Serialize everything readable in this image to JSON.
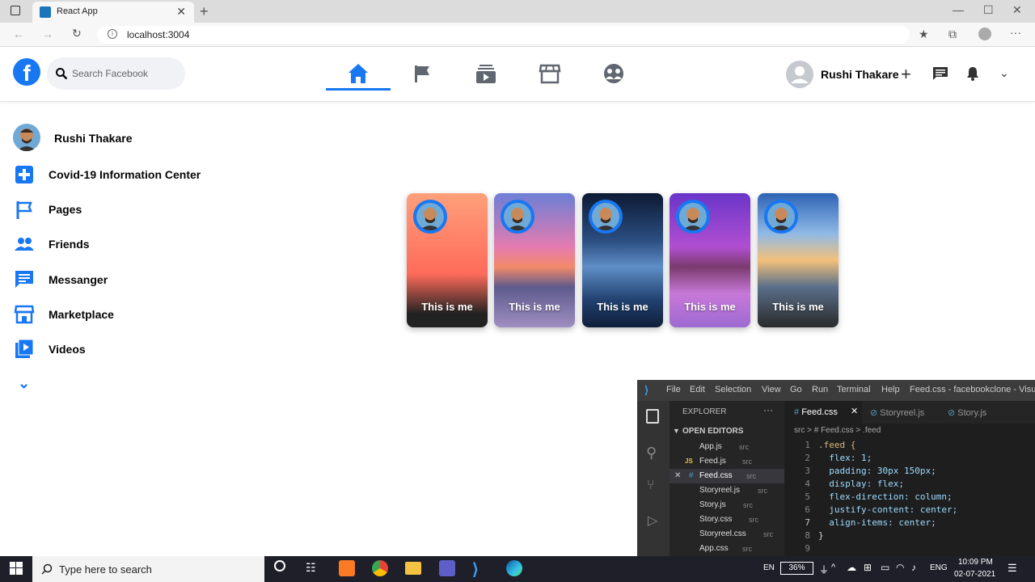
{
  "browser": {
    "tab_title": "React App",
    "url": "localhost:3004"
  },
  "header": {
    "search_placeholder": "Search Facebook",
    "user_name": "Rushi Thakare"
  },
  "sidebar": {
    "items": [
      {
        "label": "Rushi Thakare",
        "icon": "avatar"
      },
      {
        "label": "Covid-19 Information Center",
        "icon": "plus-box-icon"
      },
      {
        "label": "Pages",
        "icon": "flag-icon"
      },
      {
        "label": "Friends",
        "icon": "people-icon"
      },
      {
        "label": "Messanger",
        "icon": "chat-icon"
      },
      {
        "label": "Marketplace",
        "icon": "store-icon"
      },
      {
        "label": "Videos",
        "icon": "video-library-icon"
      }
    ]
  },
  "stories": [
    {
      "caption": "This is me"
    },
    {
      "caption": "This is me"
    },
    {
      "caption": "This is me"
    },
    {
      "caption": "This is me"
    },
    {
      "caption": "This is me"
    }
  ],
  "vscode": {
    "menu": [
      "File",
      "Edit",
      "Selection",
      "View",
      "Go",
      "Run",
      "Terminal",
      "Help"
    ],
    "window_title": "Feed.css - facebookclone - Visual S",
    "explorer_title": "EXPLORER",
    "open_editors": "OPEN EDITORS",
    "files": [
      {
        "name": "App.js",
        "dir": "src"
      },
      {
        "name": "Feed.js",
        "dir": "src"
      },
      {
        "name": "Feed.css",
        "dir": "src"
      },
      {
        "name": "Storyreel.js",
        "dir": "src"
      },
      {
        "name": "Story.js",
        "dir": "src"
      },
      {
        "name": "Story.css",
        "dir": "src"
      },
      {
        "name": "Storyreel.css",
        "dir": "src"
      },
      {
        "name": "App.css",
        "dir": "src"
      }
    ],
    "tabs": [
      "Feed.css",
      "Storyreel.js",
      "Story.js"
    ],
    "breadcrumb": "src > # Feed.css > .feed",
    "code": [
      ".feed {",
      "  flex: 1;",
      "  padding: 30px 150px;",
      "  display: flex;",
      "  flex-direction: column;",
      "  justify-content: center;",
      "  align-items: center;",
      "}"
    ],
    "line_numbers": [
      "1",
      "2",
      "3",
      "4",
      "5",
      "6",
      "7",
      "8",
      "9"
    ]
  },
  "taskbar": {
    "search_placeholder": "Type here to search",
    "lang": "EN",
    "battery": "36%",
    "input_lang": "ENG",
    "time": "10:09 PM",
    "date": "02-07-2021"
  },
  "colors": {
    "fb_blue": "#1877f2",
    "taskbar": "#1f1f2a"
  }
}
